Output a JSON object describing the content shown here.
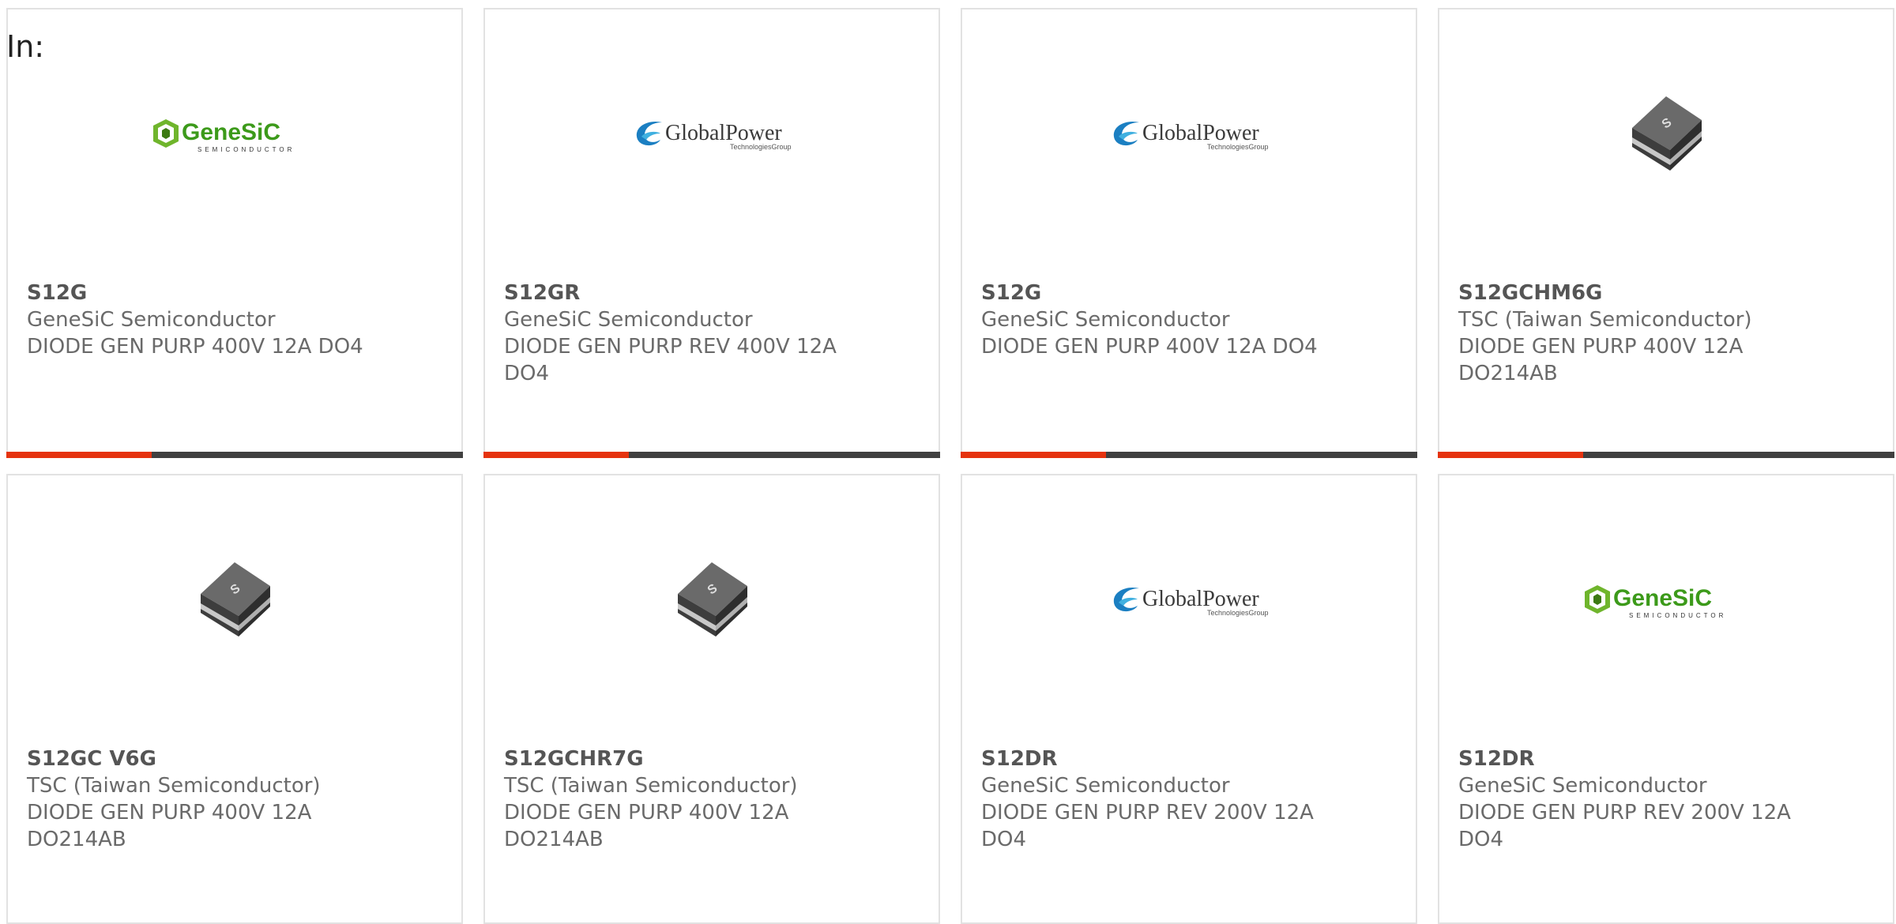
{
  "header": {
    "prefix": "In:"
  },
  "colors": {
    "card_border": "#e2e2e2",
    "bar_dark": "#404040",
    "bar_accent": "#e5330f",
    "text_grey": "#6a6a6a"
  },
  "products": [
    {
      "part": "S12G",
      "manufacturer": "GeneSiC Semiconductor",
      "description": "DIODE GEN PURP 400V 12A DO4",
      "image": "genesic-logo",
      "logo_text": "GeneSiC",
      "logo_sub": "SEMICONDUCTOR"
    },
    {
      "part": "S12GR",
      "manufacturer": "GeneSiC Semiconductor",
      "description": "DIODE GEN PURP REV 400V 12A DO4",
      "image": "globalpower-logo",
      "logo_text": "GlobalPower",
      "logo_sub": "TechnologiesGroup"
    },
    {
      "part": "S12G",
      "manufacturer": "GeneSiC Semiconductor",
      "description": "DIODE GEN PURP 400V 12A DO4",
      "image": "globalpower-logo",
      "logo_text": "GlobalPower",
      "logo_sub": "TechnologiesGroup"
    },
    {
      "part": "S12GCHM6G",
      "manufacturer": "TSC (Taiwan Semiconductor)",
      "description": "DIODE GEN PURP 400V 12A DO214AB",
      "image": "diode-package-image"
    },
    {
      "part": "S12GC V6G",
      "manufacturer": "TSC (Taiwan Semiconductor)",
      "description": "DIODE GEN PURP 400V 12A DO214AB",
      "image": "diode-package-image"
    },
    {
      "part": "S12GCHR7G",
      "manufacturer": "TSC (Taiwan Semiconductor)",
      "description": "DIODE GEN PURP 400V 12A DO214AB",
      "image": "diode-package-image"
    },
    {
      "part": "S12DR",
      "manufacturer": "GeneSiC Semiconductor",
      "description": "DIODE GEN PURP REV 200V 12A DO4",
      "image": "globalpower-logo",
      "logo_text": "GlobalPower",
      "logo_sub": "TechnologiesGroup"
    },
    {
      "part": "S12DR",
      "manufacturer": "GeneSiC Semiconductor",
      "description": "DIODE GEN PURP REV 200V 12A DO4",
      "image": "genesic-logo",
      "logo_text": "GeneSiC",
      "logo_sub": "SEMICONDUCTOR"
    }
  ]
}
